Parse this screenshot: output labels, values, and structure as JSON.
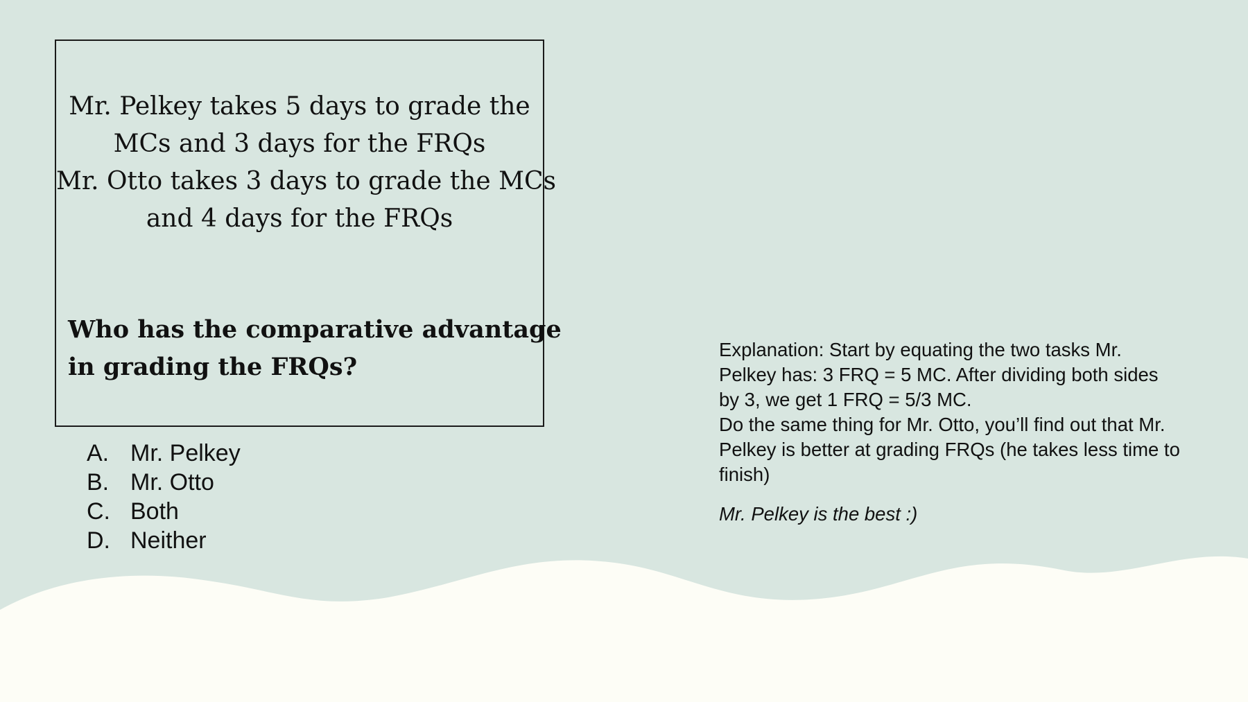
{
  "colors": {
    "background": "#d8e6e0",
    "wave_fill": "#fdfdf6",
    "text": "#111111",
    "box_border": "#1a1a1a"
  },
  "question": {
    "premise_lines": [
      "Mr. Pelkey takes 5 days to grade the",
      "MCs and 3 days for the FRQs",
      "Mr. Otto takes 3 days to grade the MCs",
      "and 4 days for the FRQs"
    ],
    "prompt_lines": [
      "Who has the comparative advantage",
      "in grading the FRQs?"
    ]
  },
  "choices": [
    {
      "letter": "A.",
      "text": "Mr. Pelkey"
    },
    {
      "letter": "B.",
      "text": "Mr. Otto"
    },
    {
      "letter": "C.",
      "text": "Both"
    },
    {
      "letter": "D.",
      "text": "Neither"
    }
  ],
  "explanation": {
    "lines": [
      "Explanation: Start by equating the two tasks Mr.",
      "Pelkey has: 3 FRQ = 5 MC. After dividing both sides",
      "by 3, we get 1 FRQ = 5/3 MC.",
      "Do the same thing for Mr. Otto, you’ll find out that Mr.",
      "Pelkey is better at grading FRQs (he takes less time to",
      "finish)"
    ],
    "closing": "Mr. Pelkey is the best :)"
  }
}
